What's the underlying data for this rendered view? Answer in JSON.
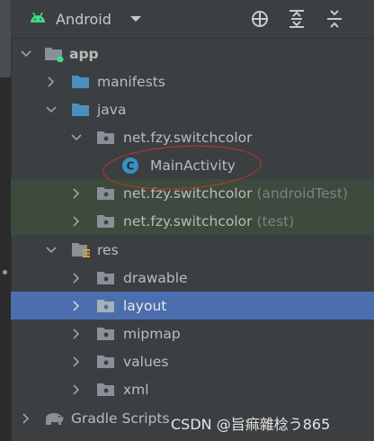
{
  "toolbar": {
    "view_label": "Android",
    "buttons": [
      "locate-icon",
      "expand-all-icon",
      "collapse-all-icon"
    ]
  },
  "tree": {
    "app": "app",
    "manifests": "manifests",
    "java": "java",
    "pkg_main": "net.fzy.switchcolor",
    "main_activity": "MainActivity",
    "class_badge": "C",
    "pkg_android_test": "net.fzy.switchcolor",
    "pkg_android_test_suffix": "(androidTest)",
    "pkg_test": "net.fzy.switchcolor",
    "pkg_test_suffix": "(test)",
    "res": "res",
    "drawable": "drawable",
    "layout": "layout",
    "mipmap": "mipmap",
    "values": "values",
    "xml": "xml",
    "gradle_scripts": "Gradle Scripts"
  },
  "watermark": "CSDN @旨痲雜棯う865",
  "colors": {
    "background": "#3c3f41",
    "selected_row": "#4b6eaf",
    "test_row": "#3e4a3d",
    "android_green": "#3ddc84",
    "folder_blue": "#4a8fc0",
    "annotation_red": "#c0392b"
  }
}
